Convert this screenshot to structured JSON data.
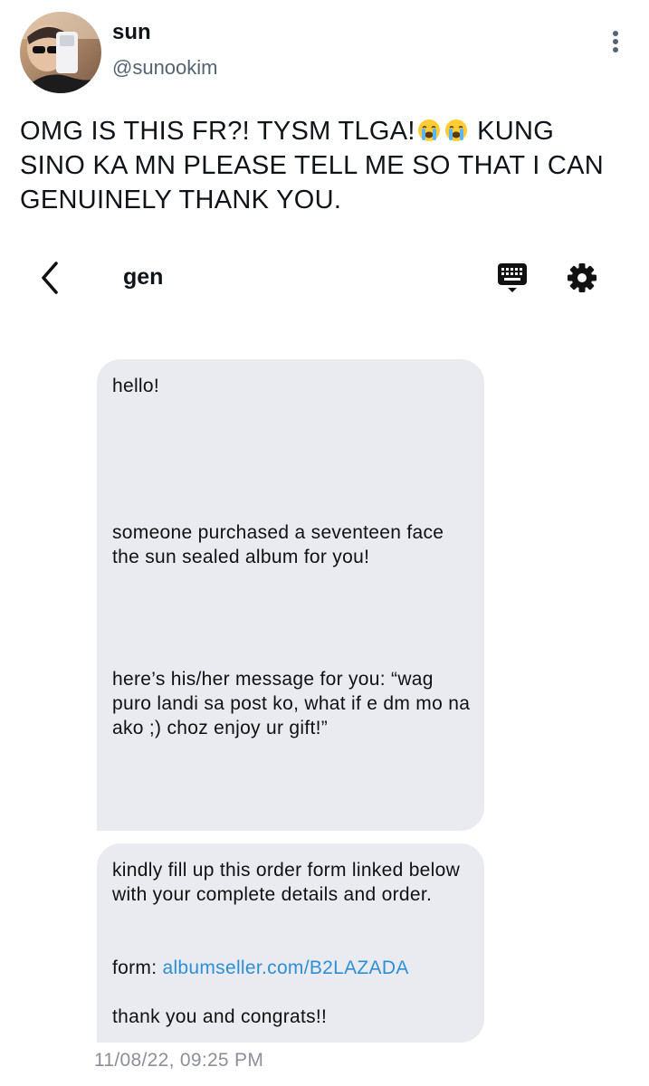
{
  "tweet": {
    "display_name": "sun",
    "handle": "@sunookim",
    "text_part1": "OMG IS THIS FR?! TYSM TLGA!",
    "text_part2": " KUNG SINO KA MN PLEASE TELL ME SO THAT I CAN GENUINELY THANK YOU."
  },
  "icons": {
    "more": "more-vertical-icon",
    "emoji": "loudly-crying-face-icon",
    "back": "chevron-left-icon",
    "keyboard": "keyboard-icon",
    "settings": "gear-icon"
  },
  "chat": {
    "name": "gen",
    "messages": [
      {
        "p1": "hello!",
        "p2": "someone purchased a seventeen face the sun sealed album for you!",
        "p3": "here’s his/her message for you: “wag puro landi sa post ko, what if e dm mo na ako ;) choz enjoy ur gift!”"
      },
      {
        "p1": "kindly fill up this order form linked below with your complete details and order.",
        "form_label": "form: ",
        "form_link": "albumseller.com/B2LAZADA",
        "p3": "thank you and congrats!!"
      }
    ],
    "timestamp": "11/08/22, 09:25 PM"
  },
  "colors": {
    "bubble": "#e9ebf1",
    "link": "#2d8fd5",
    "secondary_text": "#536471",
    "timestamp": "#8c8f9a"
  }
}
